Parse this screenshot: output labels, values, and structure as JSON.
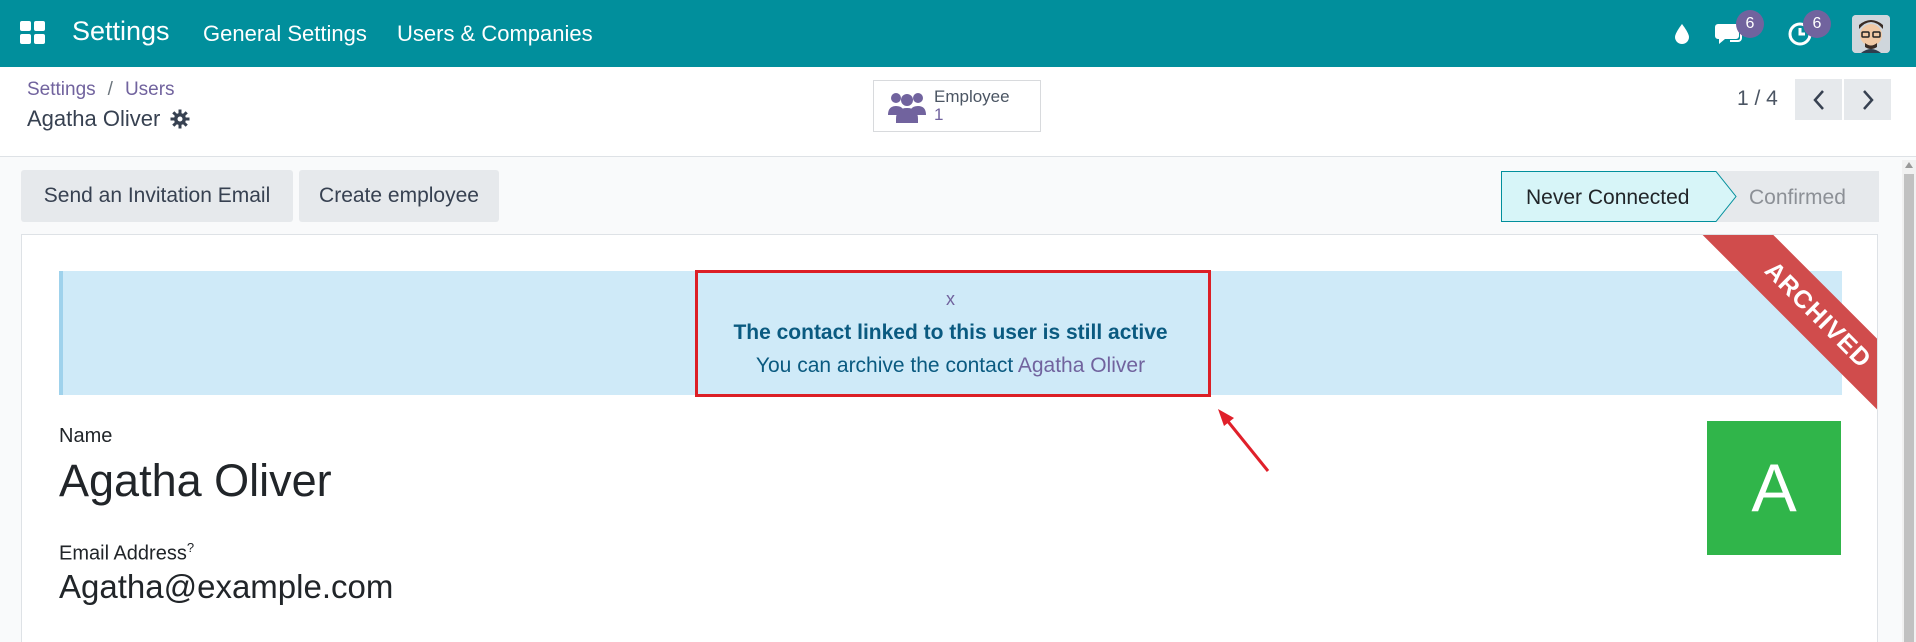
{
  "navbar": {
    "app_title": "Settings",
    "menu": [
      "General Settings",
      "Users & Companies"
    ],
    "messages_badge": "6",
    "activities_badge": "6",
    "bg_color": "#018f9c"
  },
  "breadcrumb": {
    "parent": "Settings",
    "current": "Users"
  },
  "record": {
    "title": "Agatha Oliver"
  },
  "smart_button": {
    "label": "Employee",
    "count": "1"
  },
  "pager": {
    "value": "1 / 4"
  },
  "actions": {
    "invite": "Send an Invitation Email",
    "create_employee": "Create employee"
  },
  "statusbar": {
    "active": "Never Connected",
    "next": "Confirmed"
  },
  "alert": {
    "close": "x",
    "title": "The contact linked to this user is still active",
    "message": "You can archive the contact ",
    "contact_link": "Agatha Oliver"
  },
  "ribbon": "ARCHIVED",
  "form": {
    "name_label": "Name",
    "name_value": "Agatha Oliver",
    "email_label": "Email Address",
    "email_help": "?",
    "email_value": "Agatha@example.com",
    "avatar_initial": "A"
  },
  "colors": {
    "accent": "#71639e",
    "ribbon": "#d04c4c",
    "avatar": "#30b54a",
    "highlight": "#dc1f26"
  },
  "icons": [
    "apps-grid-icon",
    "droplet-icon",
    "chat-icon",
    "clock-icon",
    "gear-icon",
    "employees-icon",
    "chevron-left-icon",
    "chevron-right-icon"
  ]
}
